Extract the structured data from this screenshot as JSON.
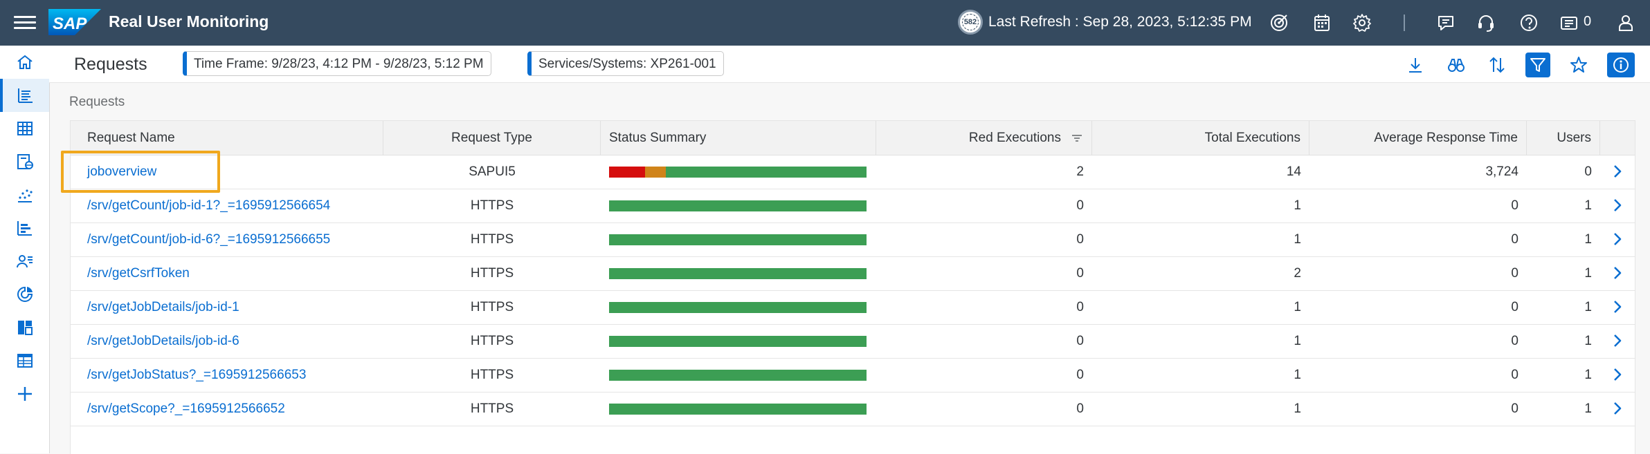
{
  "shell": {
    "app_title": "Real User Monitoring",
    "logo_text": "SAP",
    "refresh_counter": "582",
    "last_refresh": "Last Refresh : Sep 28, 2023, 5:12:35 PM",
    "notification_count": "0",
    "icons": [
      "target-icon",
      "calendar-icon",
      "settings-icon",
      "feedback-icon",
      "headset-icon",
      "help-icon",
      "notifications-icon",
      "user-icon"
    ]
  },
  "sidebar": {
    "items": [
      {
        "name": "home-icon",
        "active": false
      },
      {
        "name": "requests-list-icon",
        "active": true
      },
      {
        "name": "grid-table-icon",
        "active": false
      },
      {
        "name": "web-page-icon",
        "active": false
      },
      {
        "name": "scatter-chart-icon",
        "active": false
      },
      {
        "name": "bar-chart-icon",
        "active": false
      },
      {
        "name": "user-list-icon",
        "active": false
      },
      {
        "name": "donut-chart-icon",
        "active": false
      },
      {
        "name": "dashboard-tiles-icon",
        "active": false
      },
      {
        "name": "table-view-icon",
        "active": false
      },
      {
        "name": "add-icon",
        "active": false
      }
    ]
  },
  "header": {
    "title": "Requests",
    "time_frame": "Time Frame: 9/28/23, 4:12 PM - 9/28/23, 5:12 PM",
    "services": "Services/Systems: XP261-001",
    "actions": [
      "download-icon",
      "binoculars-icon",
      "sort-icon",
      "filter-icon",
      "favorite-star-icon",
      "info-icon"
    ]
  },
  "content": {
    "section_label": "Requests",
    "columns": {
      "name": "Request Name",
      "type": "Request Type",
      "status": "Status Summary",
      "red": "Red Executions",
      "total": "Total Executions",
      "avg": "Average Response Time",
      "users": "Users"
    },
    "rows": [
      {
        "name": "joboverview",
        "type": "SAPUI5",
        "red": "2",
        "total": "14",
        "avg": "3,724",
        "users": "0",
        "status": {
          "red": 0.14,
          "orange": 0.08,
          "green": 0.78
        }
      },
      {
        "name": "/srv/getCount/job-id-1?_=1695912566654",
        "type": "HTTPS",
        "red": "0",
        "total": "1",
        "avg": "0",
        "users": "1",
        "status": {
          "red": 0,
          "orange": 0,
          "green": 1
        }
      },
      {
        "name": "/srv/getCount/job-id-6?_=1695912566655",
        "type": "HTTPS",
        "red": "0",
        "total": "1",
        "avg": "0",
        "users": "1",
        "status": {
          "red": 0,
          "orange": 0,
          "green": 1
        }
      },
      {
        "name": "/srv/getCsrfToken",
        "type": "HTTPS",
        "red": "0",
        "total": "2",
        "avg": "0",
        "users": "1",
        "status": {
          "red": 0,
          "orange": 0,
          "green": 1
        }
      },
      {
        "name": "/srv/getJobDetails/job-id-1",
        "type": "HTTPS",
        "red": "0",
        "total": "1",
        "avg": "0",
        "users": "1",
        "status": {
          "red": 0,
          "orange": 0,
          "green": 1
        }
      },
      {
        "name": "/srv/getJobDetails/job-id-6",
        "type": "HTTPS",
        "red": "0",
        "total": "1",
        "avg": "0",
        "users": "1",
        "status": {
          "red": 0,
          "orange": 0,
          "green": 1
        }
      },
      {
        "name": "/srv/getJobStatus?_=1695912566653",
        "type": "HTTPS",
        "red": "0",
        "total": "1",
        "avg": "0",
        "users": "1",
        "status": {
          "red": 0,
          "orange": 0,
          "green": 1
        }
      },
      {
        "name": "/srv/getScope?_=1695912566652",
        "type": "HTTPS",
        "red": "0",
        "total": "1",
        "avg": "0",
        "users": "1",
        "status": {
          "red": 0,
          "orange": 0,
          "green": 1
        }
      }
    ]
  },
  "colors": {
    "shell_bg": "#354a5f",
    "accent": "#0a6ed1",
    "status_red": "#d50e0e",
    "status_orange": "#d0841a",
    "status_green": "#3c9e54",
    "highlight": "#f0a81e"
  }
}
